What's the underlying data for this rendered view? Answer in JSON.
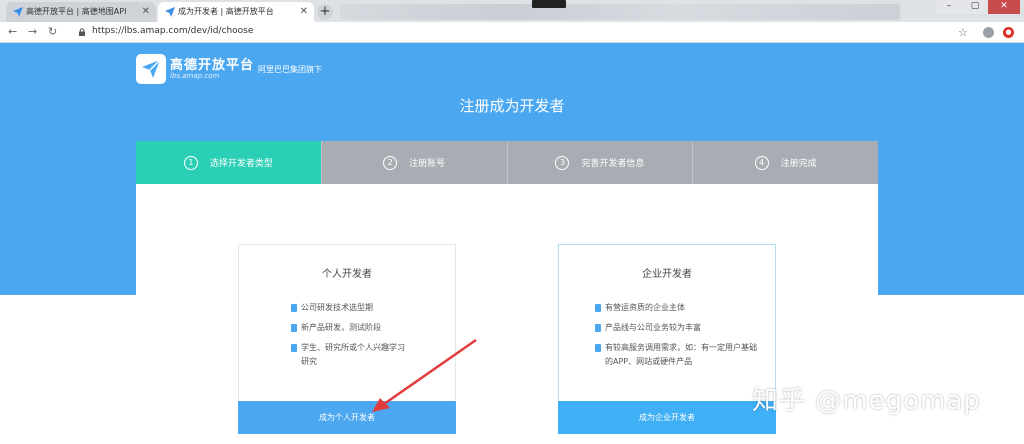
{
  "browser": {
    "tabs": [
      {
        "label": "高德开放平台 | 高德地图API"
      },
      {
        "label": "成为开发者 | 高德开放平台"
      }
    ],
    "new_tab": "+",
    "url": "https://lbs.amap.com/dev/id/choose"
  },
  "header": {
    "brand": "高德开放平台",
    "domain": "lbs.amap.com",
    "tagline": "阿里巴巴集团旗下"
  },
  "page_title": "注册成为开发者",
  "steps": [
    {
      "num": "1",
      "label": "选择开发者类型",
      "active": true
    },
    {
      "num": "2",
      "label": "注册账号",
      "active": false
    },
    {
      "num": "3",
      "label": "完善开发者信息",
      "active": false
    },
    {
      "num": "4",
      "label": "注册完成",
      "active": false
    }
  ],
  "options": [
    {
      "title": "个人开发者",
      "bullets": [
        "公司研发技术选型期",
        "新产品研发，测试阶段",
        "学生、研究所或个人兴趣学习研究"
      ],
      "button": "成为个人开发者"
    },
    {
      "title": "企业开发者",
      "bullets": [
        "有营运资质的企业主体",
        "产品线与公司业务较为丰富",
        "有较高服务调用需求，如：有一定用户基础的APP、网站或硬件产品"
      ],
      "button": "成为企业开发者"
    }
  ],
  "watermark": "知乎 @megomap",
  "colors": {
    "primary": "#4ba7f0",
    "active_step": "#2bcfb5",
    "inactive_step": "#a9acb3",
    "arrow": "#e23b3b"
  }
}
